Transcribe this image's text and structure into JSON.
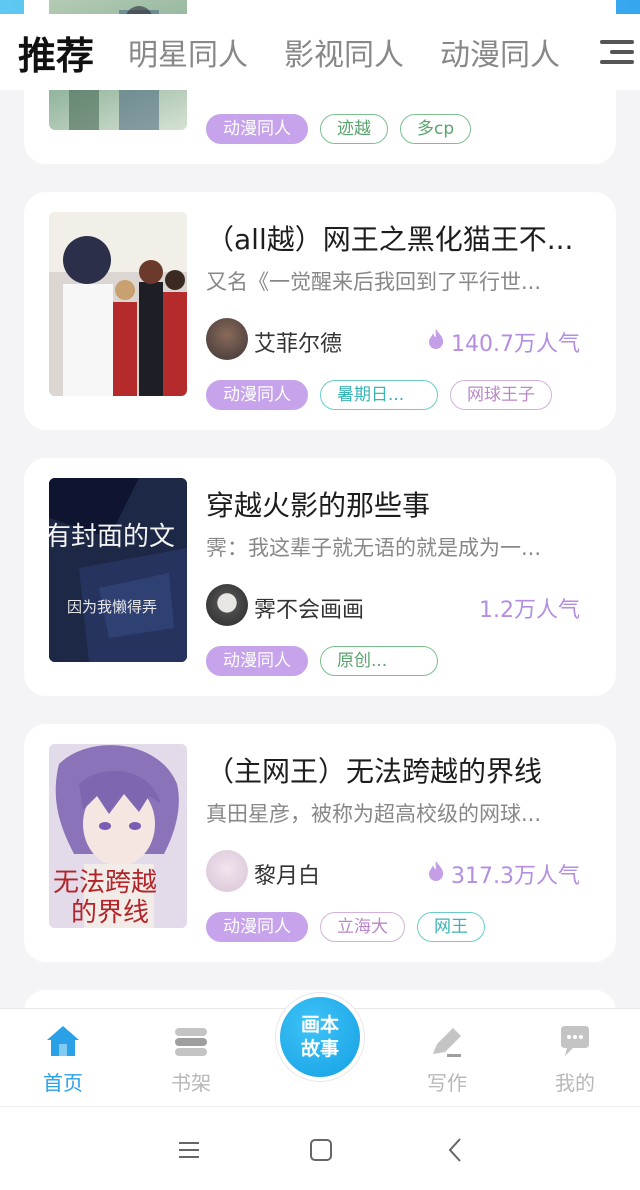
{
  "header": {
    "tabs": [
      "推荐",
      "明星同人",
      "影视同人",
      "动漫同人"
    ]
  },
  "cards": [
    {
      "title": "",
      "desc": "",
      "author": "",
      "popularity": "",
      "tags": [
        "动漫同人",
        "迹越",
        "多cp"
      ]
    },
    {
      "title": "（all越）网王之黑化猫王不...",
      "desc": "又名《一觉醒来后我回到了平行世...",
      "author": "艾菲尔德",
      "popularity": "140.7万人气",
      "tags": [
        "动漫同人",
        "暑期日...",
        "网球王子"
      ]
    },
    {
      "title": "穿越火影的那些事",
      "desc": "霁：我这辈子就无语的就是成为一...",
      "author": "霁不会画画",
      "popularity": "1.2万人气",
      "cover_text": [
        "有封面的文",
        "因为我懒得弄"
      ],
      "tags": [
        "动漫同人",
        "原创..."
      ]
    },
    {
      "title": "（主网王）无法跨越的界线",
      "desc": "真田星彦，被称为超高校级的网球...",
      "author": "黎月白",
      "popularity": "317.3万人气",
      "cover_text": [
        "无法跨越",
        "的界线"
      ],
      "tags": [
        "动漫同人",
        "立海大",
        "网王"
      ]
    }
  ],
  "bottom_nav": {
    "home": "首页",
    "bookshelf": "书架",
    "center_line1": "画本",
    "center_line2": "故事",
    "write": "写作",
    "mine": "我的"
  },
  "colors": {
    "accent_blue": "#2aa0e6",
    "accent_purple": "#c6a3eb",
    "popularity": "#b48ee0"
  },
  "icons": [
    "home-icon",
    "bookshelf-icon",
    "pen-icon",
    "chat-icon",
    "flame-icon",
    "menu-icon"
  ]
}
